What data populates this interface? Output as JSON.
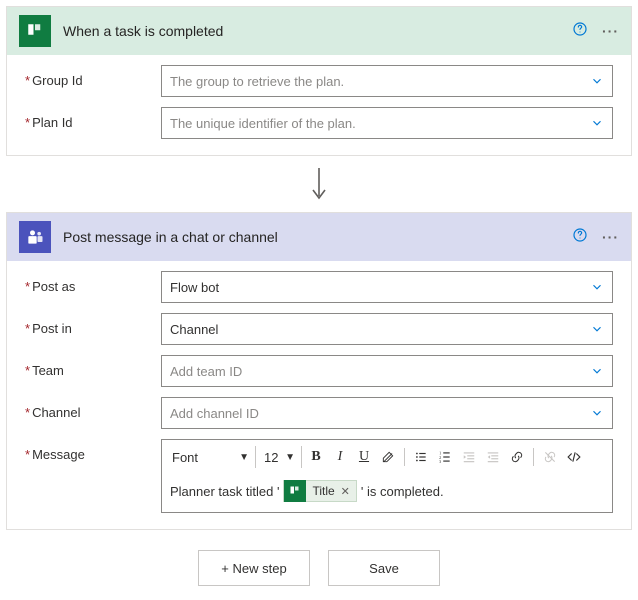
{
  "trigger": {
    "title": "When a task is completed",
    "fields": {
      "group": {
        "label": "Group Id",
        "placeholder": "The group to retrieve the plan."
      },
      "plan": {
        "label": "Plan Id",
        "placeholder": "The unique identifier of the plan."
      }
    }
  },
  "action": {
    "title": "Post message in a chat or channel",
    "fields": {
      "postAs": {
        "label": "Post as",
        "value": "Flow bot"
      },
      "postIn": {
        "label": "Post in",
        "value": "Channel"
      },
      "team": {
        "label": "Team",
        "placeholder": "Add team ID"
      },
      "channel": {
        "label": "Channel",
        "placeholder": "Add channel ID"
      },
      "message": {
        "label": "Message"
      }
    },
    "toolbar": {
      "font": "Font",
      "size": "12"
    },
    "messageBody": {
      "before": "Planner task titled '",
      "tokenLabel": "Title",
      "after": "' is completed."
    }
  },
  "footer": {
    "newStep": "+ New step",
    "save": "Save"
  }
}
